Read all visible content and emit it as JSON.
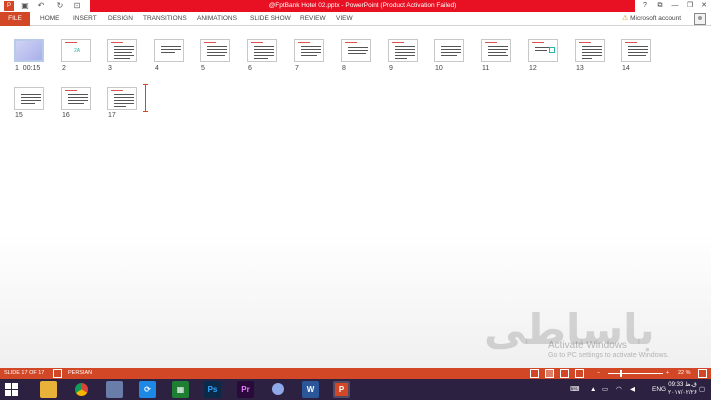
{
  "window": {
    "title": "@FptBank Hotel 02.pptx -  PowerPoint (Product Activation Failed)",
    "controls": [
      "?",
      "⧉",
      "—",
      "❐",
      "✕"
    ]
  },
  "ribbon": {
    "file": "FILE",
    "tabs": [
      "HOME",
      "INSERT",
      "DESIGN",
      "TRANSITIONS",
      "ANIMATIONS",
      "SLIDE SHOW",
      "REVIEW",
      "VIEW"
    ],
    "account": "Microsoft account"
  },
  "slides": [
    {
      "num": "1",
      "timing": "00:15"
    },
    {
      "num": "2"
    },
    {
      "num": "3"
    },
    {
      "num": "4"
    },
    {
      "num": "5"
    },
    {
      "num": "6"
    },
    {
      "num": "7"
    },
    {
      "num": "8"
    },
    {
      "num": "9"
    },
    {
      "num": "10"
    },
    {
      "num": "11"
    },
    {
      "num": "12"
    },
    {
      "num": "13"
    },
    {
      "num": "14"
    },
    {
      "num": "15"
    },
    {
      "num": "16"
    },
    {
      "num": "17"
    }
  ],
  "status": {
    "slide": "SLIDE 17 OF 17",
    "language": "PERSIAN",
    "zoom": "22 %",
    "zoom_level": 0.22
  },
  "watermark": {
    "logo": "باساطی",
    "line1": "Activate Windows",
    "line2": "Go to PC settings to activate Windows."
  },
  "taskbar": {
    "lang": "ENG",
    "time": "09:33 ق.ظ",
    "date": "۲۰۱۷/۰۲/۲۶"
  },
  "colors": {
    "accent": "#d24726",
    "title_bar": "#e81123",
    "taskbar": "#2c2140"
  }
}
